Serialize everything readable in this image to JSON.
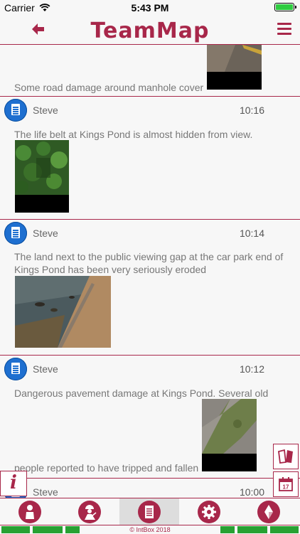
{
  "status_bar": {
    "carrier": "Carrier",
    "time": "5:43 PM",
    "battery_level": 1.0
  },
  "header": {
    "logo": "TeamMap"
  },
  "entries": [
    {
      "text": "Some road damage around manhole cover"
    },
    {
      "user": "Steve",
      "time": "10:16",
      "text": "The life belt at Kings Pond is almost hidden from view."
    },
    {
      "user": "Steve",
      "time": "10:14",
      "text": "The land next to the public viewing gap at the car park end of Kings Pond has been very seriously eroded"
    },
    {
      "user": "Steve",
      "time": "10:12",
      "text_line1": "Dangerous pavement damage at Kings Pond. Several old",
      "text_line2": "people reported to have tripped and fallen"
    },
    {
      "user": "Steve",
      "time": "10:00"
    }
  ],
  "tabs": [
    "person",
    "worker",
    "documents",
    "settings",
    "compass"
  ],
  "active_tab": "documents",
  "footer": {
    "text": "© IntBox 2018"
  },
  "colors": {
    "accent": "#a8274a",
    "icon_blue": "#1e6fd0",
    "footer_green": "#27a132"
  }
}
